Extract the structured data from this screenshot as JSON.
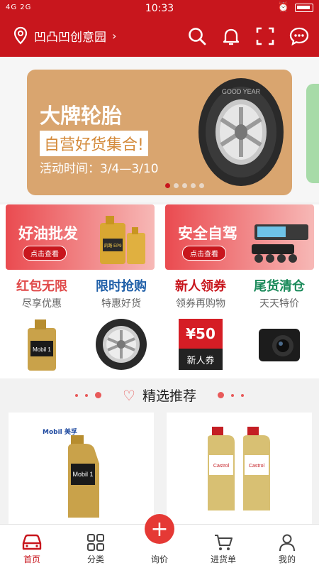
{
  "status": {
    "signal": "4G 2G",
    "time": "10:33"
  },
  "header": {
    "location": "凹凸凹创意园"
  },
  "banner": {
    "title": "大牌轮胎",
    "subtitle": "自营好货集合!",
    "date": "活动时间：3/4—3/10",
    "tire_text": "GOOD YEAR"
  },
  "promos": [
    {
      "title": "好油批发",
      "button": "点击查看",
      "product_text": "凯路 EP9"
    },
    {
      "title": "安全自驾",
      "button": "点击查看",
      "product_text": ""
    }
  ],
  "categories": [
    {
      "title": "红包无限",
      "subtitle": "尽享优惠",
      "color": "#e04a4a",
      "product_text": "Mobil 1"
    },
    {
      "title": "限时抢购",
      "subtitle": "特惠好货",
      "color": "#1f5fa8"
    },
    {
      "title": "新人领券",
      "subtitle": "领券再购物",
      "color": "#c8161d",
      "coupon_amount": "¥50",
      "coupon_label": "新人券"
    },
    {
      "title": "尾货清仓",
      "subtitle": "天天特价",
      "color": "#1a8a5a"
    }
  ],
  "section": {
    "title": "精选推荐"
  },
  "products": [
    {
      "brand": "Mobil 美孚",
      "label": "Mobil 1"
    },
    {
      "label": "Castrol"
    }
  ],
  "tabs": [
    {
      "label": "首页"
    },
    {
      "label": "分类"
    },
    {
      "label": "询价"
    },
    {
      "label": "进货单"
    },
    {
      "label": "我的"
    }
  ]
}
